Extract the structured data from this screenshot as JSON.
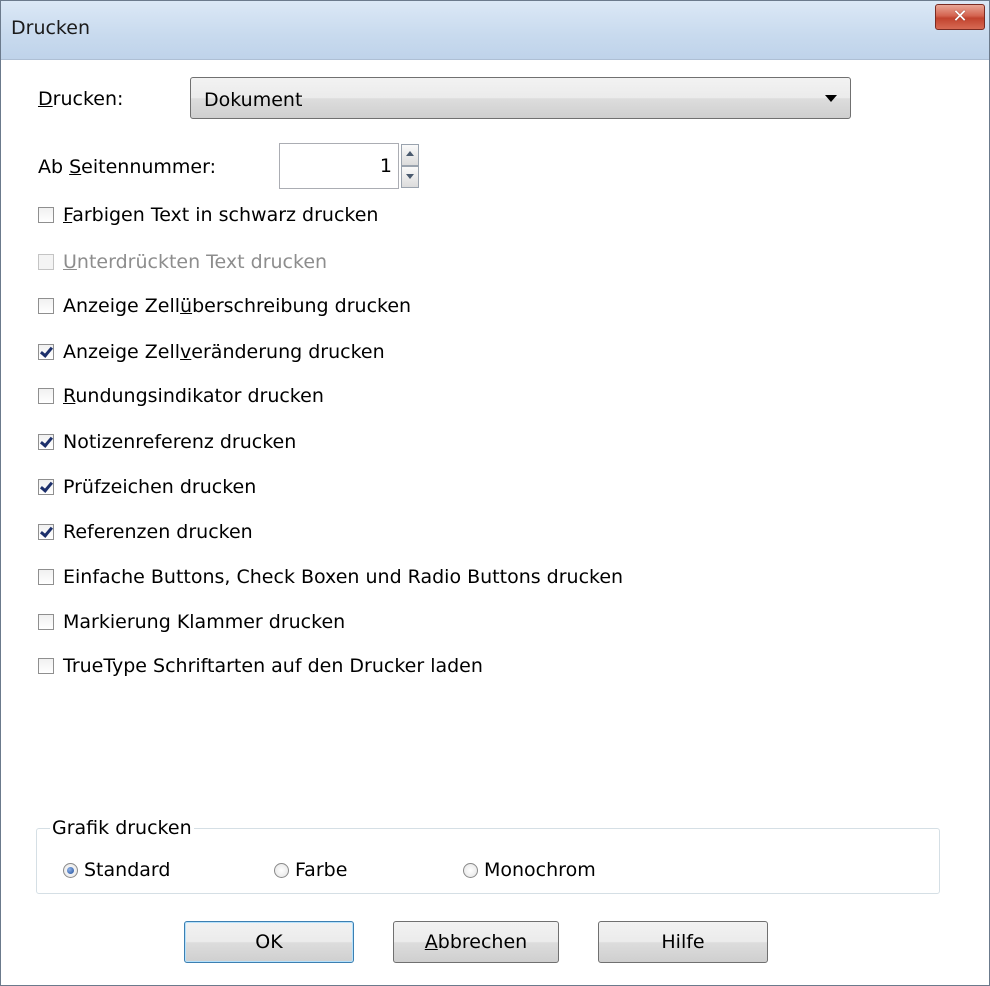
{
  "window": {
    "title": "Drucken",
    "close_icon": "close-icon"
  },
  "print_select": {
    "label_prefix": "",
    "label_mnemonic": "D",
    "label_rest": "rucken:",
    "value": "Dokument"
  },
  "start_page": {
    "label_prefix": "Ab ",
    "label_mnemonic": "S",
    "label_rest": "eitennummer:",
    "value": "1"
  },
  "options": [
    {
      "pre": "",
      "mn": "F",
      "post": "arbigen Text in schwarz drucken",
      "checked": false,
      "disabled": false
    },
    {
      "pre": "",
      "mn": "U",
      "post": "nterdrückten Text drucken",
      "checked": false,
      "disabled": true
    },
    {
      "pre": "Anzeige Zell",
      "mn": "ü",
      "post": "berschreibung drucken",
      "checked": false,
      "disabled": false
    },
    {
      "pre": "Anzeige Zell",
      "mn": "v",
      "post": "eränderung drucken",
      "checked": true,
      "disabled": false
    },
    {
      "pre": "",
      "mn": "R",
      "post": "undungsindikator drucken",
      "checked": false,
      "disabled": false
    },
    {
      "pre": "Notizenreferenz drucken",
      "mn": "",
      "post": "",
      "checked": true,
      "disabled": false
    },
    {
      "pre": "Prüfzeichen drucken",
      "mn": "",
      "post": "",
      "checked": true,
      "disabled": false
    },
    {
      "pre": "Referenzen drucken",
      "mn": "",
      "post": "",
      "checked": true,
      "disabled": false
    },
    {
      "pre": "Einfache Buttons, Check Boxen und Radio Buttons drucken",
      "mn": "",
      "post": "",
      "checked": false,
      "disabled": false
    },
    {
      "pre": "Markierung Klammer drucken",
      "mn": "",
      "post": "",
      "checked": false,
      "disabled": false
    },
    {
      "pre": "TrueType Schriftarten auf den Drucker laden",
      "mn": "",
      "post": "",
      "checked": false,
      "disabled": false
    }
  ],
  "graphics": {
    "legend": "Grafik drucken",
    "options": [
      {
        "label": "Standard",
        "checked": true
      },
      {
        "label": "Farbe",
        "checked": false
      },
      {
        "label": "Monochrom",
        "checked": false
      }
    ]
  },
  "buttons": {
    "ok": "OK",
    "cancel_mnemonic": "A",
    "cancel_rest": "bbrechen",
    "help": "Hilfe"
  },
  "colors": {
    "title_bar": "#c8daee",
    "close_button": "#c1432e",
    "default_button_border": "#3c7fb1"
  }
}
